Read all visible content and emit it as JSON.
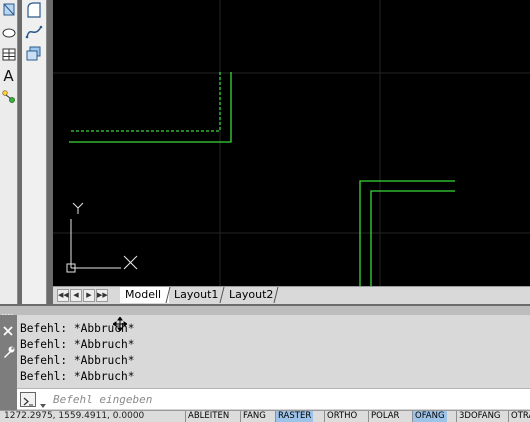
{
  "colors": {
    "canvas": "#000000",
    "grid": "#262626",
    "geometry": "#38d938",
    "ucs_icon": "#e6e6e6",
    "status_on": "#9ec3e8"
  },
  "toolbar_left": {
    "icons": [
      "polygon-icon",
      "circle-icon",
      "table-icon",
      "text-icon",
      "attribute-icon"
    ],
    "text_tool_label": "A"
  },
  "toolbar_right": {
    "icons": [
      "region-icon",
      "spline-icon",
      "block-icon"
    ]
  },
  "ucs": {
    "x_label": "X",
    "y_label": "Y"
  },
  "layout_tabs": {
    "tabs": [
      "Modell",
      "Layout1",
      "Layout2"
    ],
    "active": "Modell"
  },
  "command_window": {
    "history": [
      "Befehl: *Abbruch*",
      "Befehl: *Abbruch*",
      "Befehl: *Abbruch*",
      "Befehl: *Abbruch*"
    ],
    "input_placeholder": "Befehl eingeben"
  },
  "status_bar": {
    "coordinates": "1272.2975, 1559.4911, 0.0000",
    "toggles": [
      {
        "label": "ABLEITEN",
        "on": false
      },
      {
        "label": "FANG",
        "on": false
      },
      {
        "label": "RASTER",
        "on": true
      },
      {
        "label": "ORTHO",
        "on": false
      },
      {
        "label": "POLAR",
        "on": false
      },
      {
        "label": "OFANG",
        "on": true
      },
      {
        "label": "3DOFANG",
        "on": false
      },
      {
        "label": "OTRACK",
        "on": false
      }
    ]
  }
}
